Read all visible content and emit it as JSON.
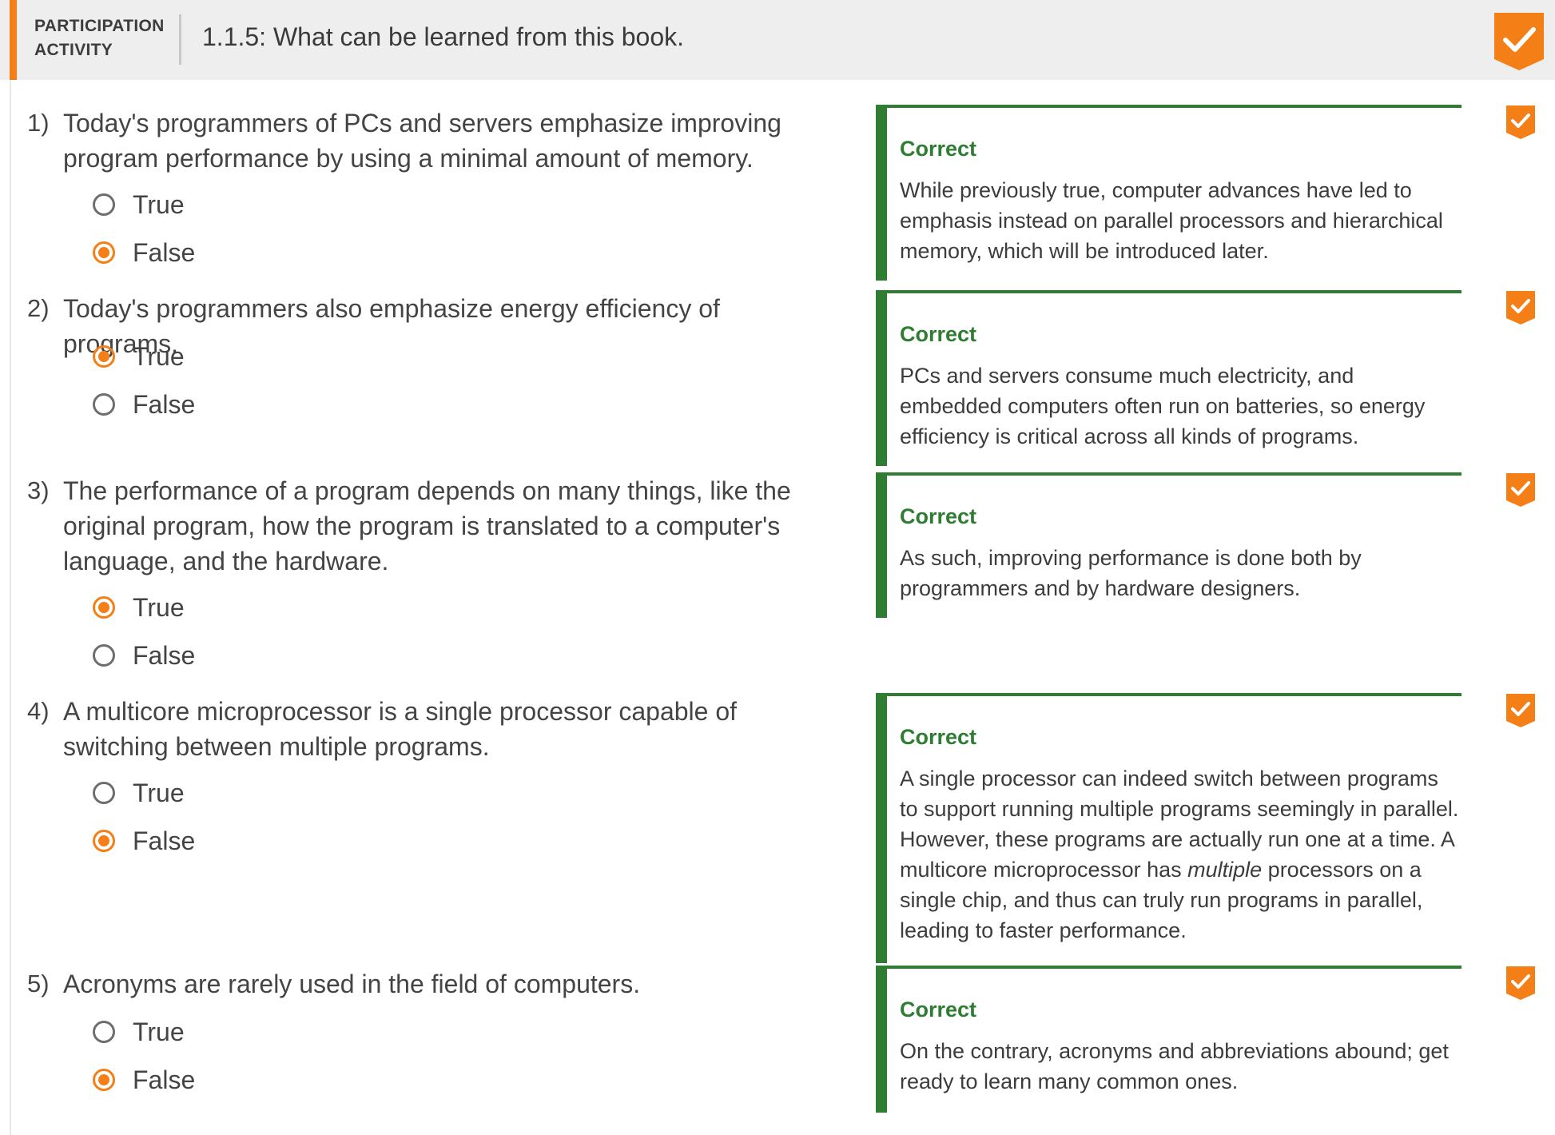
{
  "header": {
    "type_line1": "PARTICIPATION",
    "type_line2": "ACTIVITY",
    "title": "1.1.5: What can be learned from this book."
  },
  "colors": {
    "accent": "#f57f17",
    "correct": "#2e7d32",
    "header_bg": "#eeeeee"
  },
  "questions": [
    {
      "number": "1)",
      "text": "Today's programmers of PCs and servers emphasize improving program performance by using a minimal amount of memory.",
      "options": [
        {
          "label": "True",
          "selected": false
        },
        {
          "label": "False",
          "selected": true
        }
      ],
      "feedback": {
        "status": "Correct",
        "text": "While previously true, computer advances have led to emphasis instead on parallel processors and hierarchical memory, which will be introduced later."
      },
      "completed_icon": "check-badge-icon"
    },
    {
      "number": "2)",
      "text": "Today's programmers also emphasize energy efficiency of programs.",
      "options": [
        {
          "label": "True",
          "selected": true
        },
        {
          "label": "False",
          "selected": false
        }
      ],
      "feedback": {
        "status": "Correct",
        "text": "PCs and servers consume much electricity, and embedded computers often run on batteries, so energy efficiency is critical across all kinds of programs."
      },
      "completed_icon": "check-badge-icon"
    },
    {
      "number": "3)",
      "text": "The performance of a program depends on many things, like the original program, how the program is translated to a computer's language, and the hardware.",
      "options": [
        {
          "label": "True",
          "selected": true
        },
        {
          "label": "False",
          "selected": false
        }
      ],
      "feedback": {
        "status": "Correct",
        "text": "As such, improving performance is done both by programmers and by hardware designers."
      },
      "completed_icon": "check-badge-icon"
    },
    {
      "number": "4)",
      "text": "A multicore microprocessor is a single processor capable of switching between multiple programs.",
      "options": [
        {
          "label": "True",
          "selected": false
        },
        {
          "label": "False",
          "selected": true
        }
      ],
      "feedback": {
        "status": "Correct",
        "text_before": "A single processor can indeed switch between programs to support running multiple programs seemingly in parallel. However, these programs are actually run one at a time. A multicore microprocessor has ",
        "text_emphasis": "multiple",
        "text_after": " processors on a single chip, and thus can truly run programs in parallel, leading to faster performance."
      },
      "completed_icon": "check-badge-icon"
    },
    {
      "number": "5)",
      "text": "Acronyms are rarely used in the field of computers.",
      "options": [
        {
          "label": "True",
          "selected": false
        },
        {
          "label": "False",
          "selected": true
        }
      ],
      "feedback": {
        "status": "Correct",
        "text": "On the contrary, acronyms and abbreviations abound; get ready to learn many common ones."
      },
      "completed_icon": "check-badge-icon"
    }
  ]
}
